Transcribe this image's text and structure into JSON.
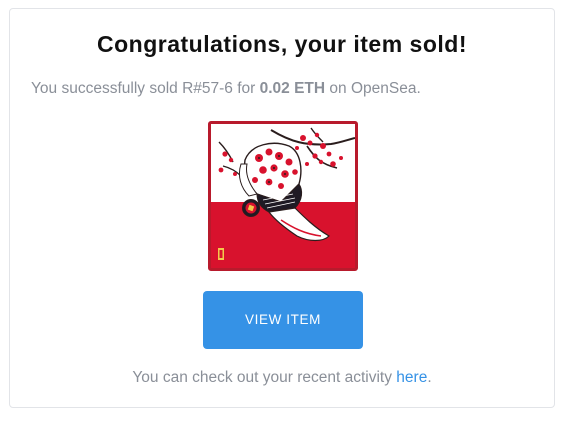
{
  "email": {
    "title": "Congratulations, your item sold!",
    "sold_prefix": "You successfully sold ",
    "item_name": "R#57-6",
    "for_text": " for ",
    "price": "0.02 ETH",
    "on_text": " on OpenSea.",
    "item_image_label": "NFT artwork: red and white kimono figure with cherry blossoms",
    "view_button_label": "VIEW ITEM",
    "footer_prefix": "You can check out your recent activity ",
    "footer_link": "here",
    "footer_suffix": "."
  },
  "colors": {
    "accent": "#3592e6",
    "nft_border": "#b81a2c",
    "nft_red": "#d8122d",
    "muted_text": "#8a8f98"
  }
}
